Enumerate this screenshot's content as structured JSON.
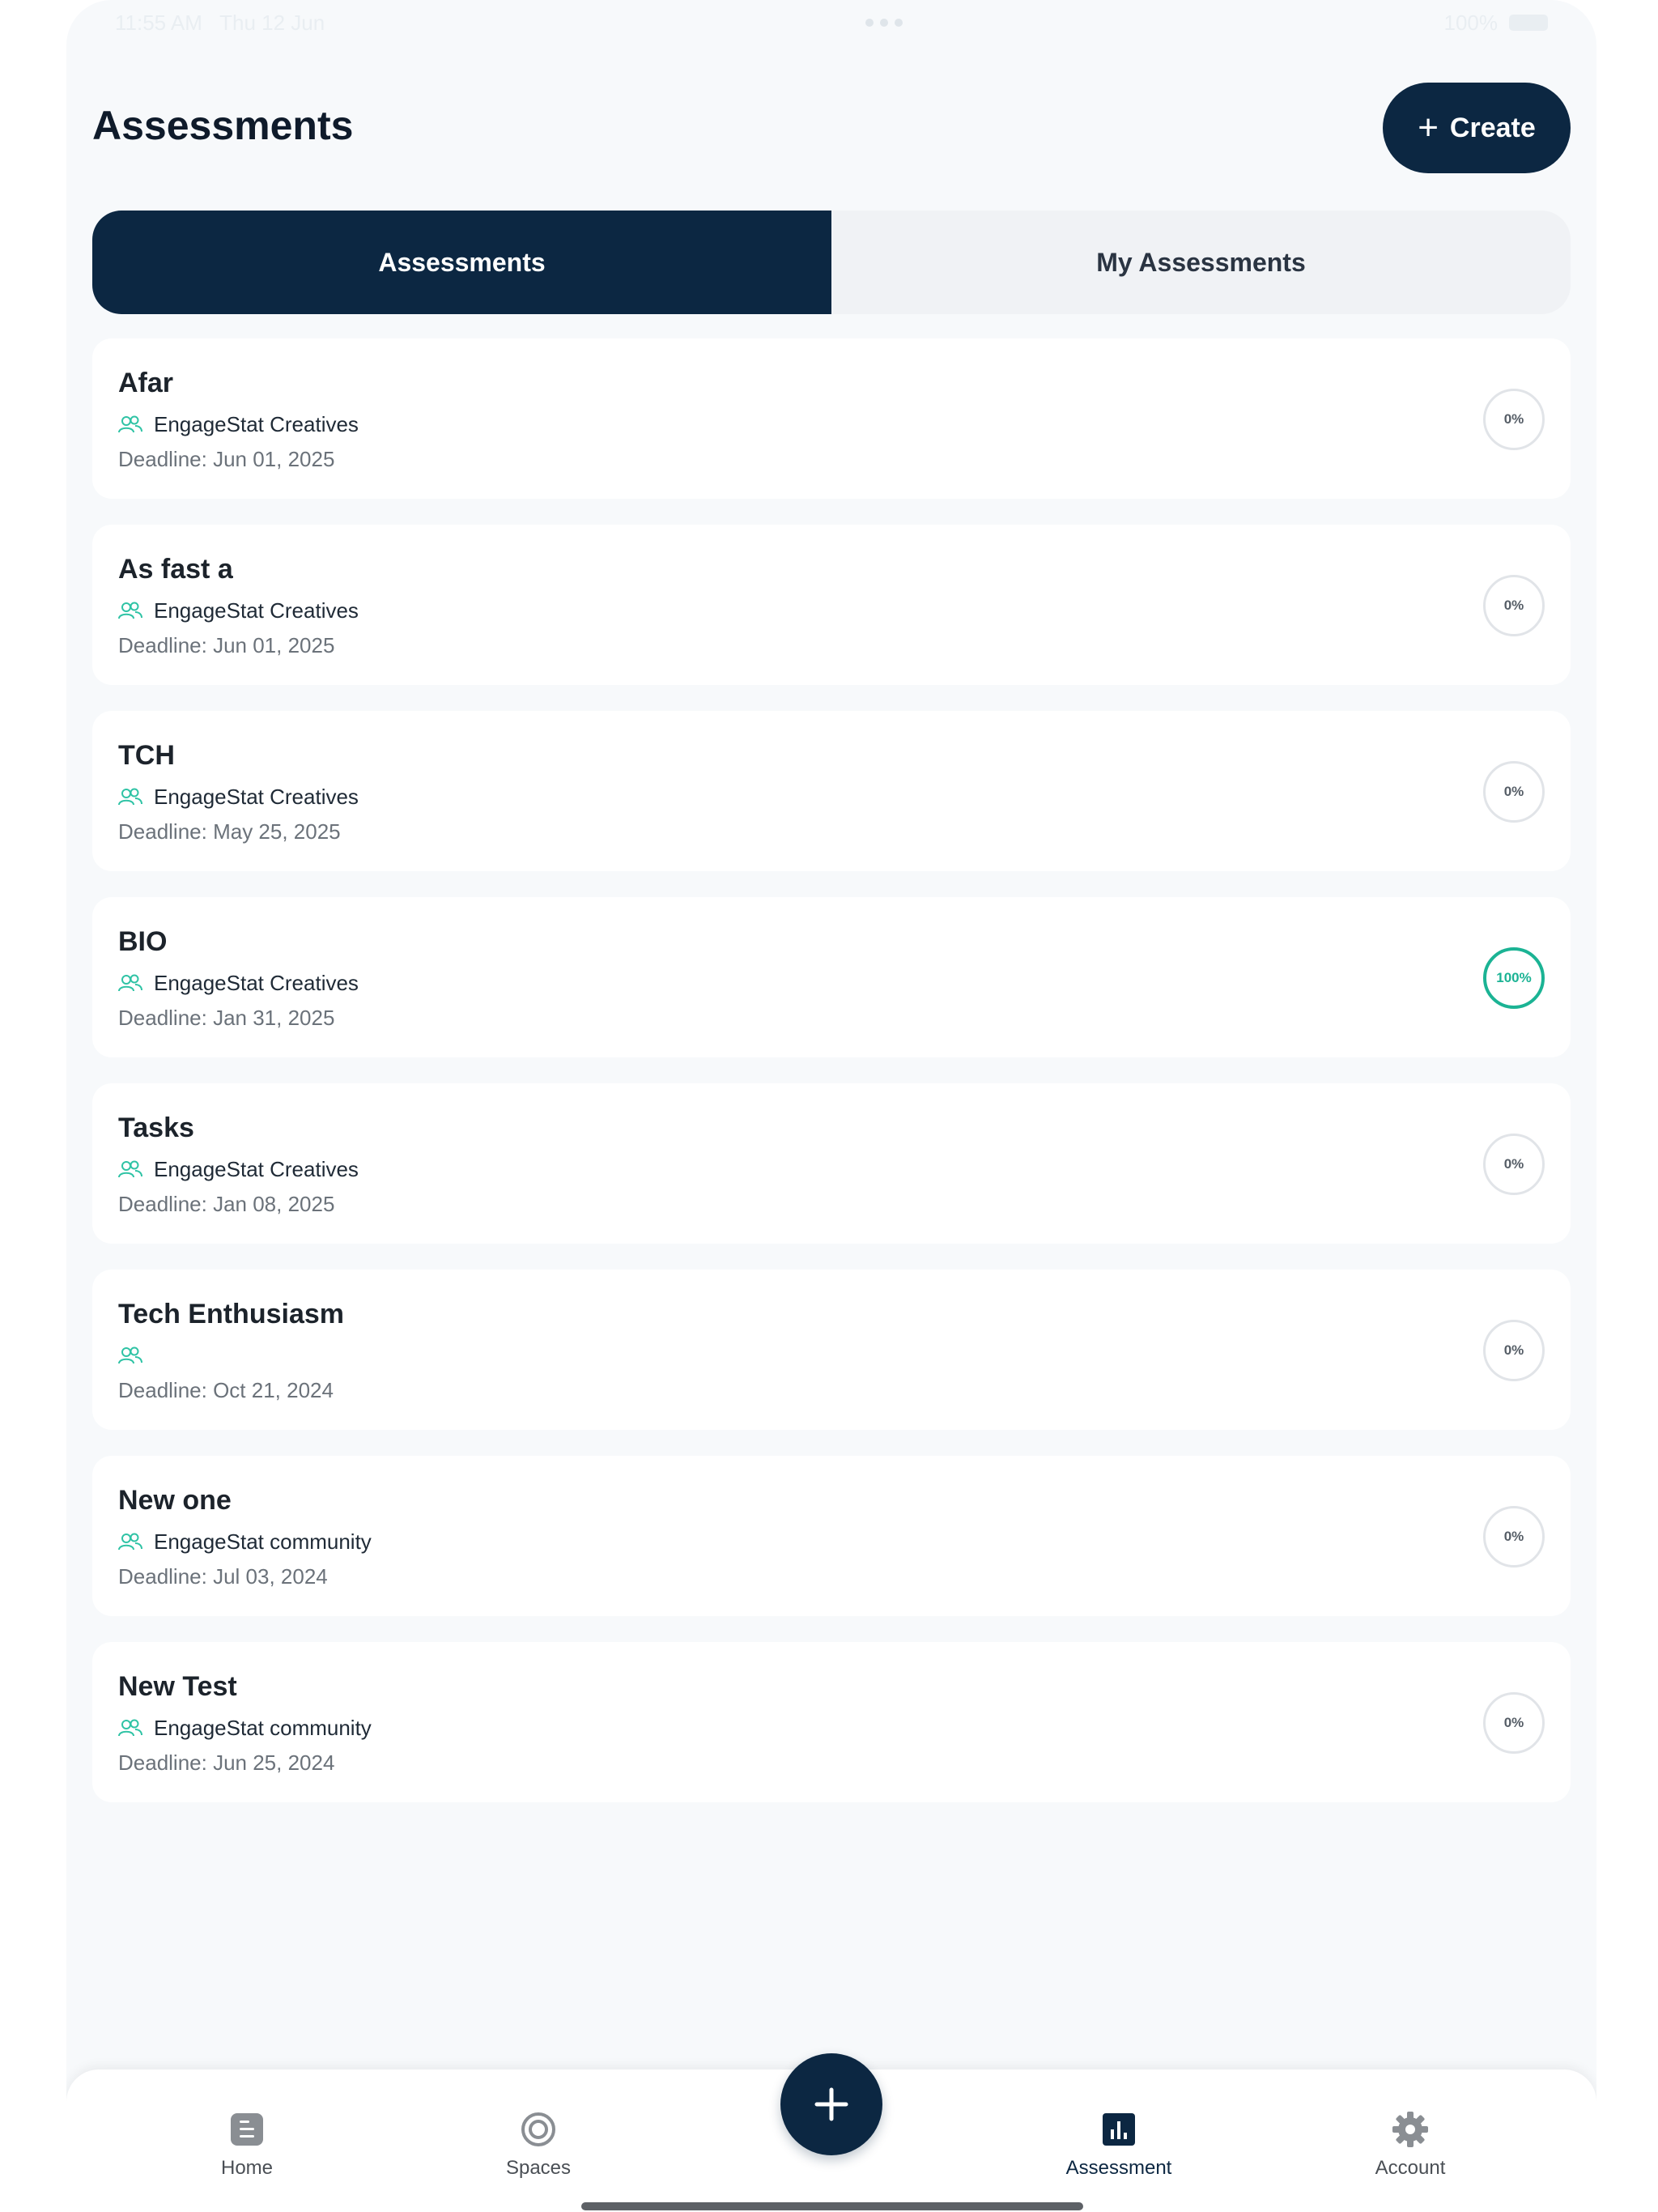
{
  "status_bar": {
    "time": "11:55 AM",
    "date": "Thu 12 Jun",
    "battery": "100%"
  },
  "header": {
    "title": "Assessments",
    "create_label": "Create"
  },
  "tabs": [
    {
      "label": "Assessments",
      "active": true
    },
    {
      "label": "My Assessments",
      "active": false
    }
  ],
  "assessments": [
    {
      "title": "Afar",
      "space": "EngageStat Creatives",
      "deadline": "Deadline: Jun 01, 2025",
      "progress": "0%"
    },
    {
      "title": "As fast a",
      "space": "EngageStat Creatives",
      "deadline": "Deadline: Jun 01, 2025",
      "progress": "0%"
    },
    {
      "title": "TCH",
      "space": "EngageStat Creatives",
      "deadline": "Deadline: May 25, 2025",
      "progress": "0%"
    },
    {
      "title": "BIO",
      "space": "EngageStat Creatives",
      "deadline": "Deadline: Jan 31, 2025",
      "progress": "100%"
    },
    {
      "title": "Tasks",
      "space": "EngageStat Creatives",
      "deadline": "Deadline: Jan 08, 2025",
      "progress": "0%"
    },
    {
      "title": "Tech Enthusiasm",
      "space": "",
      "deadline": "Deadline: Oct 21, 2024",
      "progress": "0%"
    },
    {
      "title": "New one",
      "space": "EngageStat community",
      "deadline": "Deadline: Jul 03, 2024",
      "progress": "0%"
    },
    {
      "title": "New Test",
      "space": "EngageStat community",
      "deadline": "Deadline: Jun 25, 2024",
      "progress": "0%"
    }
  ],
  "bottom_nav": [
    {
      "label": "Home",
      "icon": "home-icon",
      "active": false
    },
    {
      "label": "Spaces",
      "icon": "spaces-icon",
      "active": false
    },
    {
      "label": "Assessment",
      "icon": "assessment-icon",
      "active": true
    },
    {
      "label": "Account",
      "icon": "gear-icon",
      "active": false
    }
  ],
  "colors": {
    "primary": "#0c2742",
    "accent_green": "#1bb394",
    "people_icon": "#2fc3a5",
    "background": "#f7f9fb"
  }
}
